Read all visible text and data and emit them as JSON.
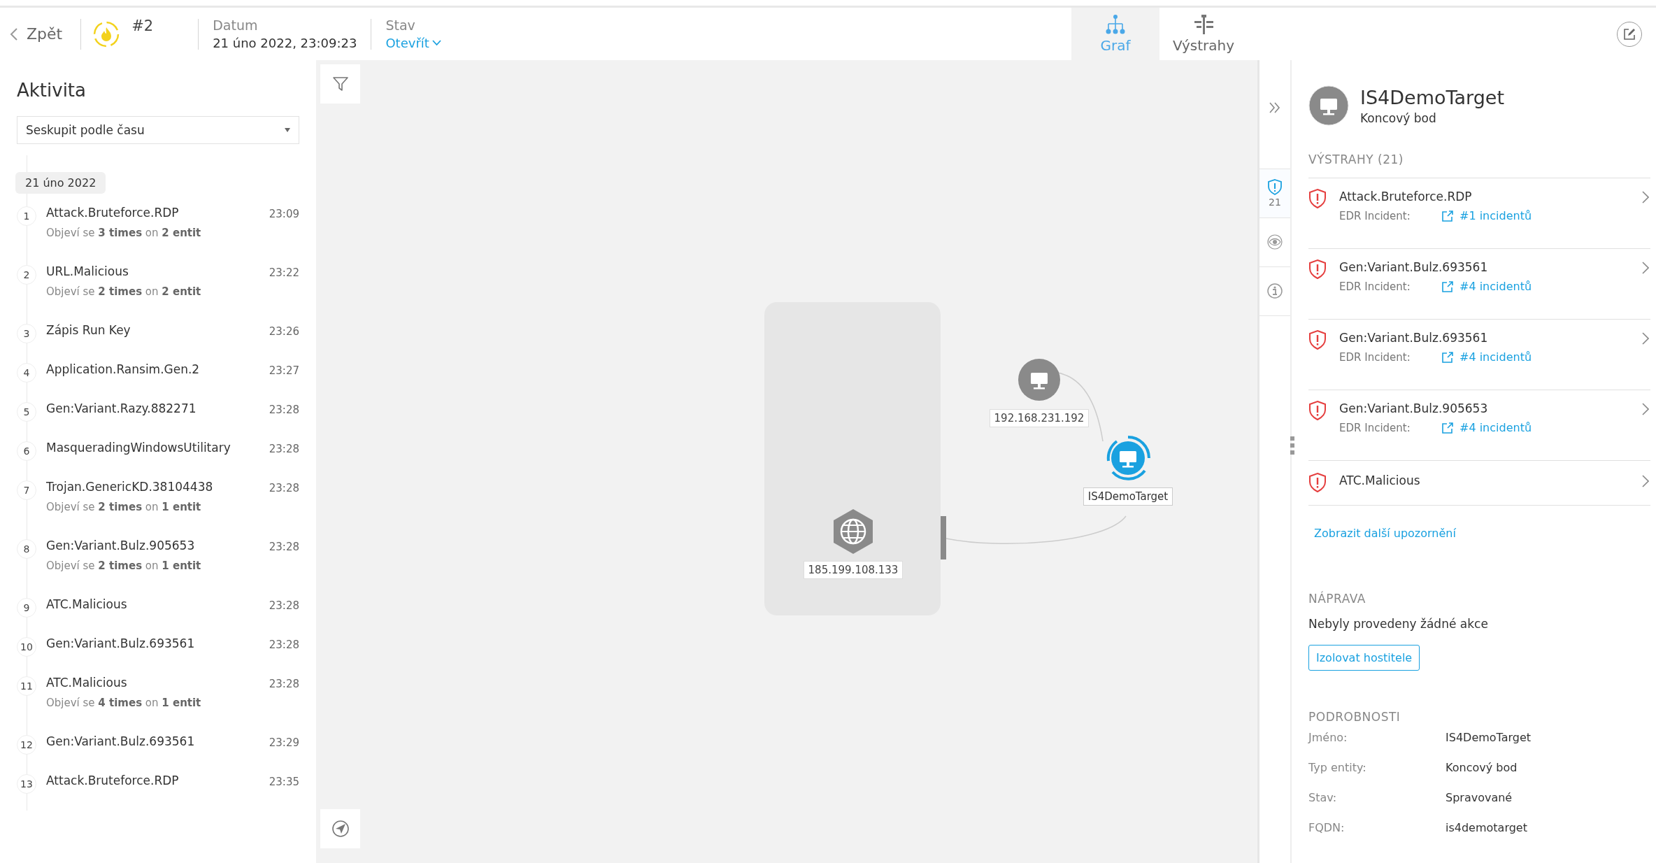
{
  "header": {
    "back_label": "Zpět",
    "incident_number": "#2",
    "date": {
      "label": "Datum",
      "value": "21 úno 2022, 23:09:23"
    },
    "status": {
      "label": "Stav",
      "value": "Otevřít"
    },
    "tabs": [
      {
        "kind": "graph",
        "label": "Graf",
        "selected": true
      },
      {
        "kind": "alerts",
        "label": "Výstrahy",
        "selected": false
      }
    ]
  },
  "activity": {
    "title": "Aktivita",
    "group_by": "Seskupit podle času",
    "date_chip": "21 úno 2022",
    "items": [
      {
        "number": "1",
        "name": "Attack.Bruteforce.RDP",
        "time": "23:09",
        "detail": "Objeví se **3 times** on **2 entit**"
      },
      {
        "number": "2",
        "name": "URL.Malicious",
        "time": "23:22",
        "detail": "Objeví se **2 times** on **2 entit**"
      },
      {
        "number": "3",
        "name": "Zápis Run Key",
        "time": "23:26"
      },
      {
        "number": "4",
        "name": "Application.Ransim.Gen.2",
        "time": "23:27"
      },
      {
        "number": "5",
        "name": "Gen:Variant.Razy.882271",
        "time": "23:28"
      },
      {
        "number": "6",
        "name": "MasqueradingWindowsUtilitary",
        "time": "23:28"
      },
      {
        "number": "7",
        "name": "Trojan.GenericKD.38104438",
        "time": "23:28",
        "detail": "Objeví se **2 times** on **1 entit**"
      },
      {
        "number": "8",
        "name": "Gen:Variant.Bulz.905653",
        "time": "23:28",
        "detail": "Objeví se **2 times** on **1 entit**"
      },
      {
        "number": "9",
        "name": "ATC.Malicious",
        "time": "23:28"
      },
      {
        "number": "10",
        "name": "Gen:Variant.Bulz.693561",
        "time": "23:28"
      },
      {
        "number": "11",
        "name": "ATC.Malicious",
        "time": "23:28",
        "detail": "Objeví se **4 times** on **1 entit**"
      },
      {
        "number": "12",
        "name": "Gen:Variant.Bulz.693561",
        "time": "23:29"
      },
      {
        "number": "13",
        "name": "Attack.Bruteforce.RDP",
        "time": "23:35"
      }
    ]
  },
  "graph": {
    "nodes": [
      {
        "kind": "globe",
        "label": "185.199.108.133",
        "selected": false
      },
      {
        "kind": "endpoint",
        "label": "192.168.231.192",
        "selected": false
      },
      {
        "kind": "endpoint",
        "label": "IS4DemoTarget",
        "selected": true
      }
    ]
  },
  "details_panel": {
    "side_tabs": [
      {
        "kind": "alerts",
        "count": "21",
        "selected": true
      },
      {
        "kind": "eye",
        "selected": false
      },
      {
        "kind": "info",
        "selected": false
      }
    ],
    "entity": {
      "name": "IS4DemoTarget",
      "type": "Koncový bod"
    },
    "alerts_heading": "VÝSTRAHY (21)",
    "alerts": [
      {
        "name": "Attack.Bruteforce.RDP",
        "incident_label": "EDR Incident:",
        "incident_link": "#1 incidentů"
      },
      {
        "name": "Gen:Variant.Bulz.693561",
        "incident_label": "EDR Incident:",
        "incident_link": "#4 incidentů"
      },
      {
        "name": "Gen:Variant.Bulz.693561",
        "incident_label": "EDR Incident:",
        "incident_link": "#4 incidentů"
      },
      {
        "name": "Gen:Variant.Bulz.905653",
        "incident_label": "EDR Incident:",
        "incident_link": "#4 incidentů"
      },
      {
        "name": "ATC.Malicious"
      }
    ],
    "more_link": "Zobrazit další upozornění",
    "remediation_heading": "NÁPRAVA",
    "remediation_text": "Nebyly provedeny žádné akce",
    "isolate_button": "Izolovat hostitele",
    "details_heading": "PODROBNOSTI",
    "details": [
      {
        "label": "Jméno:",
        "value": "IS4DemoTarget"
      },
      {
        "label": "Typ entity:",
        "value": "Koncový bod"
      },
      {
        "label": "Stav:",
        "value": "Spravované"
      },
      {
        "label": "FQDN:",
        "value": "is4demotarget"
      }
    ]
  }
}
